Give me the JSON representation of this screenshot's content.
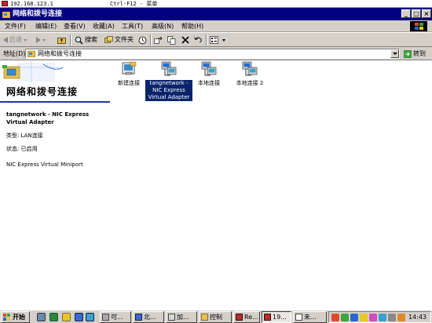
{
  "remote": {
    "host": "192.168.123.1",
    "hint": "Ctrl-F12 - 菜单"
  },
  "window": {
    "title": "网络和拨号连接"
  },
  "menu": [
    "文件(F)",
    "编辑(E)",
    "查看(V)",
    "收藏(A)",
    "工具(T)",
    "高级(N)",
    "帮助(H)"
  ],
  "toolbar": {
    "back": "后退",
    "search": "搜索",
    "folders": "文件夹"
  },
  "address": {
    "label": "地址(D)",
    "value": "网络和拨号连接",
    "go": "转到"
  },
  "panel": {
    "title": "网络和拨号连接",
    "selected_name": "tangnetwork - NIC Express Virtual Adapter",
    "type_label": "类型: LAN连接",
    "status_label": "状态: 已启用",
    "device": "NIC Express Virtual Miniport"
  },
  "icons": [
    {
      "name": "新建连接",
      "kind": "new"
    },
    {
      "name": "tangnetwork - NIC Express Virtual Adapter",
      "kind": "lan",
      "selected": true
    },
    {
      "name": "本地连接",
      "kind": "lan"
    },
    {
      "name": "本地连接 2",
      "kind": "lan"
    }
  ],
  "taskbar": {
    "start": "开始",
    "tasks": [
      "可...",
      "北...",
      "加...",
      "控制",
      "Re...",
      "19...",
      "未..."
    ],
    "clock": "14:43"
  },
  "colors": {
    "titlebar": "#000080",
    "chrome": "#d4d0c8",
    "selection": "#0a246a",
    "panel_line": "#1e3aa8"
  }
}
